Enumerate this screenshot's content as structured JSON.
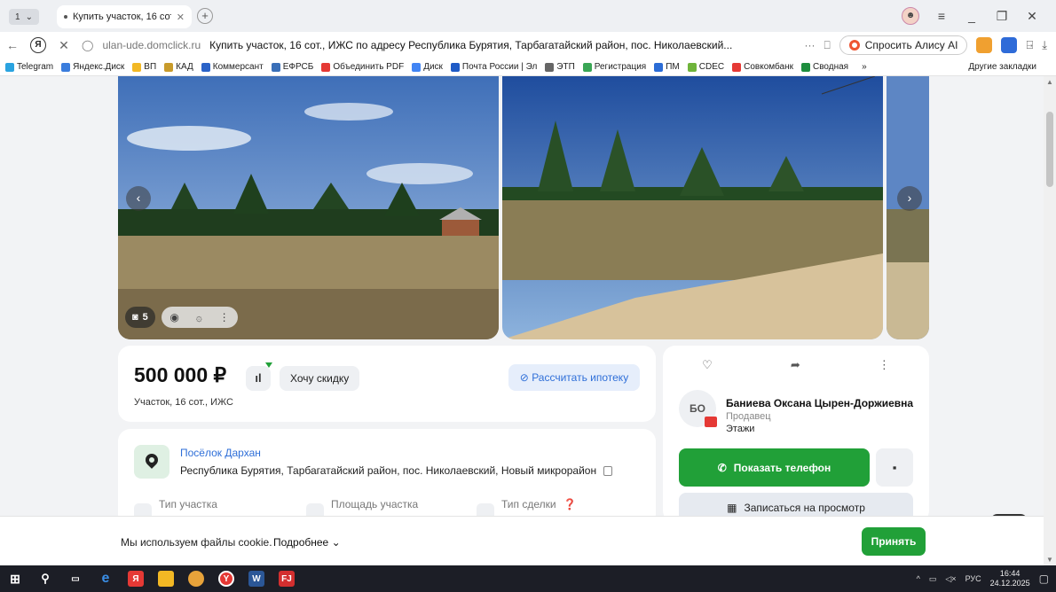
{
  "browser": {
    "tab_counter": "1",
    "tab_title": "Купить участок, 16 сот",
    "domain": "ulan-ude.domclick.ru",
    "page_title": "Купить участок, 16 сот., ИЖС по адресу Республика Бурятия, Тарбагатайский район, пос. Николаевский...",
    "more": "···",
    "alisa_label": "Спросить Алису AI"
  },
  "bookmarks": {
    "items": [
      {
        "label": "Telegram",
        "color": "#2aa3e0"
      },
      {
        "label": "Яндекс.Диск",
        "color": "#3b7ddd"
      },
      {
        "label": "ВП",
        "color": "#f2b824"
      },
      {
        "label": "КАД",
        "color": "#c89b2b"
      },
      {
        "label": "Коммерсант",
        "color": "#2b63c8"
      },
      {
        "label": "ЕФРСБ",
        "color": "#3a6fb8"
      },
      {
        "label": "Объединить PDF",
        "color": "#e53935"
      },
      {
        "label": "Диск",
        "color": "#4285f4"
      },
      {
        "label": "Почта России | Эл",
        "color": "#1f5bc6"
      },
      {
        "label": "ЭТП",
        "color": "#666666"
      },
      {
        "label": "Регистрация",
        "color": "#3aa655"
      },
      {
        "label": "ПМ",
        "color": "#2b6cd6"
      },
      {
        "label": "CDEC",
        "color": "#6fb43b"
      },
      {
        "label": "Совкомбанк",
        "color": "#e53935"
      },
      {
        "label": "Сводная",
        "color": "#1e8e3e"
      }
    ],
    "more": "»",
    "other": "Другие закладки"
  },
  "gallery": {
    "photo_count": "5"
  },
  "listing": {
    "price": "500 000 ₽",
    "discount_label": "Хочу скидку",
    "mortgage_label": "Рассчитать ипотеку",
    "subtitle": "Участок, 16 сот., ИЖС",
    "settlement": "Посёлок Дархан",
    "address": "Республика Бурятия, Тарбагатайский район, пос. Николаевский, Новый микрорайон",
    "params": [
      {
        "label": "Тип участка"
      },
      {
        "label": "Площадь участка"
      },
      {
        "label": "Тип сделки"
      }
    ]
  },
  "seller": {
    "initials": "БО",
    "name": "Баниева Оксана Цырен-Доржиевна",
    "role": "Продавец",
    "agency": "Этажи",
    "phone_label": "Показать телефон",
    "viewing_label": "Записаться на просмотр"
  },
  "cookie": {
    "text": "Мы используем файлы cookie.",
    "more": "Подробнее",
    "accept": "Принять"
  },
  "taskbar": {
    "lang": "РУС",
    "time": "16:44",
    "date": "24.12.2025"
  },
  "colors": {
    "accent_green": "#21a038",
    "link_blue": "#2f6fd8"
  }
}
